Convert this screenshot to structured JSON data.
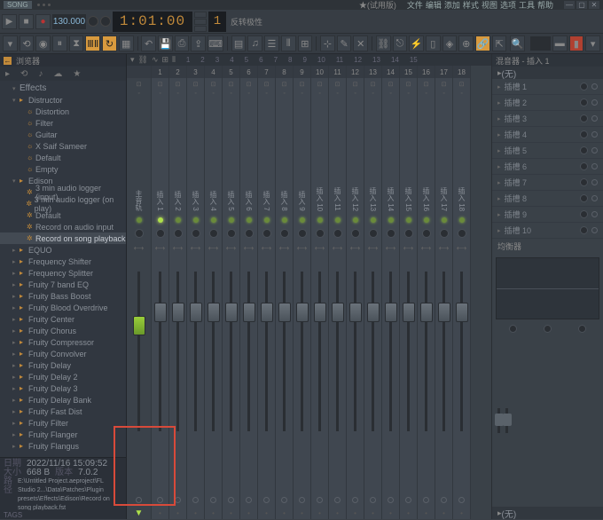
{
  "topbar": {
    "song_btn": "SONG",
    "title": "★(试用版)",
    "menus": [
      "文件",
      "编辑",
      "添加",
      "样式",
      "视图",
      "选项",
      "工具",
      "帮助"
    ]
  },
  "toolbar": {
    "tempo": "130.000",
    "time": "1:01:00",
    "counter": "1",
    "pattern": "反转极性"
  },
  "browser": {
    "tab_label": "浏览器",
    "effects_hd": "Effects",
    "items": [
      {
        "l": 1,
        "t": "Distructor",
        "exp": true
      },
      {
        "l": 2,
        "t": "Distortion",
        "ico": "☼"
      },
      {
        "l": 2,
        "t": "Filter",
        "ico": "☼"
      },
      {
        "l": 2,
        "t": "Guitar",
        "ico": "☼"
      },
      {
        "l": 2,
        "t": "X Saif Sameer",
        "ico": "☼"
      },
      {
        "l": 2,
        "t": "Default",
        "ico": "☼"
      },
      {
        "l": 2,
        "t": "Empty",
        "ico": "☼"
      },
      {
        "l": 1,
        "t": "Edison",
        "exp": true
      },
      {
        "l": 2,
        "t": "3 min audio logger (input)",
        "ico": "✲"
      },
      {
        "l": 2,
        "t": "3 min audio logger (on play)",
        "ico": "✲"
      },
      {
        "l": 2,
        "t": "Default",
        "ico": "✲"
      },
      {
        "l": 2,
        "t": "Record on audio input",
        "ico": "✲"
      },
      {
        "l": 2,
        "t": "Record on song playback",
        "ico": "✲",
        "sel": true
      },
      {
        "l": 1,
        "t": "EQUO"
      },
      {
        "l": 1,
        "t": "Frequency Shifter"
      },
      {
        "l": 1,
        "t": "Frequency Splitter"
      },
      {
        "l": 1,
        "t": "Fruity 7 band EQ"
      },
      {
        "l": 1,
        "t": "Fruity Bass Boost"
      },
      {
        "l": 1,
        "t": "Fruity Blood Overdrive"
      },
      {
        "l": 1,
        "t": "Fruity Center"
      },
      {
        "l": 1,
        "t": "Fruity Chorus"
      },
      {
        "l": 1,
        "t": "Fruity Compressor"
      },
      {
        "l": 1,
        "t": "Fruity Convolver"
      },
      {
        "l": 1,
        "t": "Fruity Delay"
      },
      {
        "l": 1,
        "t": "Fruity Delay 2"
      },
      {
        "l": 1,
        "t": "Fruity Delay 3"
      },
      {
        "l": 1,
        "t": "Fruity Delay Bank"
      },
      {
        "l": 1,
        "t": "Fruity Fast Dist"
      },
      {
        "l": 1,
        "t": "Fruity Filter"
      },
      {
        "l": 1,
        "t": "Fruity Flanger"
      },
      {
        "l": 1,
        "t": "Fruity Flangus"
      }
    ],
    "footer": {
      "date_lbl": "日期",
      "date": "2022/11/16 15:09:52",
      "size_lbl": "大小",
      "size": "668 B",
      "ver_lbl": "版本",
      "ver": "7.0.2",
      "path_lbl": "路径",
      "path": "E:\\Untitled Project.aeproject\\FL Studio 2...\\Data\\Patches\\Plugin presets\\Effects\\Edison\\Record on song playback.fst"
    },
    "tags": "TAGS"
  },
  "mixer": {
    "title": "混音器 - 插入 1",
    "nums": [
      "1",
      "2",
      "3",
      "4",
      "5",
      "6",
      "7",
      "8",
      "9",
      "10",
      "11",
      "12",
      "13",
      "14",
      "15"
    ],
    "master": "主音轨",
    "insert_prefix": "插入",
    "tracks": 16,
    "sel_label": "(无)",
    "slots": [
      "插槽 1",
      "插槽 2",
      "插槽 3",
      "插槽 4",
      "插槽 5",
      "插槽 6",
      "插槽 7",
      "插槽 8",
      "插槽 9",
      "插槽 10"
    ],
    "eq_label": "均衡器",
    "foot_sel": "(无)"
  }
}
